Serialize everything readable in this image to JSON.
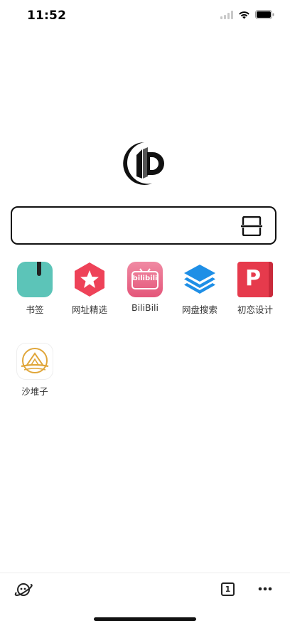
{
  "status_bar": {
    "time": "11:52"
  },
  "search": {
    "placeholder": "",
    "value": ""
  },
  "shortcuts": [
    {
      "label": "书签",
      "icon": "bookmark-icon",
      "color": "#5cc4b8"
    },
    {
      "label": "网址精选",
      "icon": "star-icon",
      "color": "#ee4258"
    },
    {
      "label": "BiliBili",
      "icon": "bilibili-icon",
      "color": "#ec6b8a",
      "badge_text": "bilibili"
    },
    {
      "label": "网盘搜索",
      "icon": "layers-icon",
      "color": "#1f8fe6"
    },
    {
      "label": "初恋设计",
      "icon": "p-icon",
      "color": "#e63a4c",
      "badge_text": "P"
    },
    {
      "label": "沙堆子",
      "icon": "sand-icon",
      "color": "#e0a63a"
    }
  ],
  "bottom_bar": {
    "tab_count": "1"
  }
}
